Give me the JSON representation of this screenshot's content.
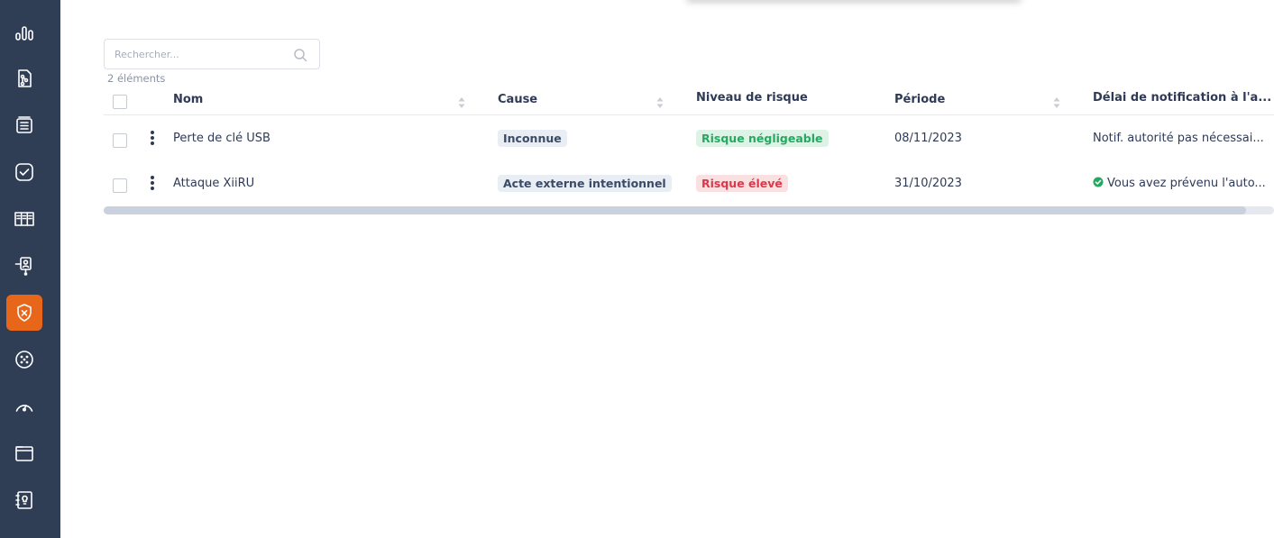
{
  "sidebar": {
    "items": [
      {
        "icon": "bar-chart-icon",
        "active": false
      },
      {
        "icon": "document-flow-icon",
        "active": false
      },
      {
        "icon": "stack-list-icon",
        "active": false
      },
      {
        "icon": "check-square-icon",
        "active": false
      },
      {
        "icon": "columns-icon",
        "active": false
      },
      {
        "icon": "person-network-icon",
        "active": false
      },
      {
        "icon": "shield-x-icon",
        "active": true
      },
      {
        "icon": "dotted-circle-icon",
        "active": false
      },
      {
        "icon": "gauge-icon",
        "active": false
      },
      {
        "icon": "folder-icon",
        "active": false
      },
      {
        "icon": "notebook-bulb-icon",
        "active": false
      }
    ],
    "active_color": "#e8661a",
    "background": "#2f3d55"
  },
  "search": {
    "placeholder": "Rechercher...",
    "value": ""
  },
  "list": {
    "count_label": "2 éléments"
  },
  "table": {
    "columns": [
      {
        "key": "name",
        "label": "Nom",
        "sortable": true
      },
      {
        "key": "cause",
        "label": "Cause",
        "sortable": true
      },
      {
        "key": "risk",
        "label": "Niveau de risque",
        "sortable": false
      },
      {
        "key": "period",
        "label": "Période",
        "sortable": true
      },
      {
        "key": "notification",
        "label": "Délai de notification à l'a..."
      }
    ],
    "rows": [
      {
        "name": "Perte de clé USB",
        "cause": "Inconnue",
        "risk": "Risque négligeable",
        "risk_level": "green",
        "period": "08/11/2023",
        "notification": "Notif. autorité pas nécessai...",
        "notification_ok": false
      },
      {
        "name": "Attaque XiiRU",
        "cause": "Acte externe intentionnel",
        "risk": "Risque élevé",
        "risk_level": "red",
        "period": "31/10/2023",
        "notification": "Vous avez prévenu l'auto...",
        "notification_ok": true
      }
    ]
  },
  "colors": {
    "risk_low_text": "#27a862",
    "risk_low_bg": "#dcf3e6",
    "risk_high_text": "#d9394a",
    "risk_high_bg": "#fbe0e2",
    "ok_check": "#27a862"
  }
}
